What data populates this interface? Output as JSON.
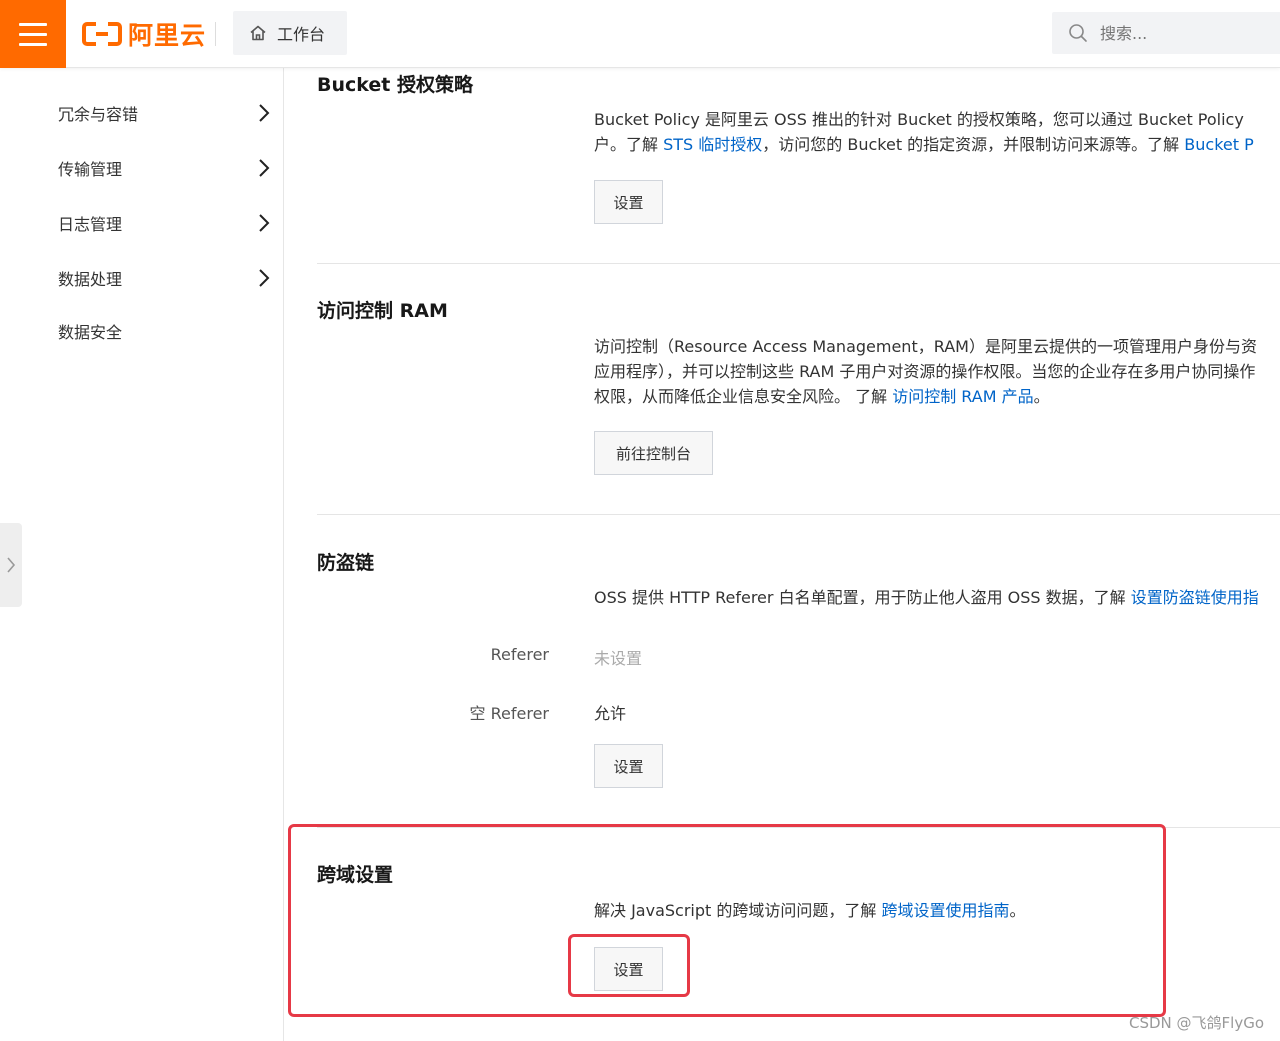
{
  "topbar": {
    "logo_text": "阿里云",
    "workbench_label": "工作台",
    "search_placeholder": "搜索..."
  },
  "sidebar": {
    "items": [
      {
        "label": "冗余与容错",
        "has_arrow": true
      },
      {
        "label": "传输管理",
        "has_arrow": true
      },
      {
        "label": "日志管理",
        "has_arrow": true
      },
      {
        "label": "数据处理",
        "has_arrow": true
      },
      {
        "label": "数据安全",
        "has_arrow": false
      }
    ]
  },
  "sections": {
    "bucket_policy": {
      "title": "Bucket 授权策略",
      "line1": "Bucket Policy 是阿里云 OSS 推出的针对 Bucket 的授权策略，您可以通过 Bucket Policy",
      "line2_prefix": "户。了解 ",
      "line2_link1": "STS 临时授权",
      "line2_middle": "，访问您的 Bucket 的指定资源，并限制访问来源等。了解 ",
      "line2_link2": "Bucket P",
      "button": "设置"
    },
    "ram": {
      "title": "访问控制 RAM",
      "line1": "访问控制（Resource Access Management，RAM）是阿里云提供的一项管理用户身份与资",
      "line2": "应用程序），并可以控制这些 RAM 子用户对资源的操作权限。当您的企业存在多用户协同操作",
      "line3_prefix": "权限，从而降低企业信息安全风险。 了解 ",
      "line3_link": "访问控制 RAM 产品",
      "line3_suffix": "。",
      "button": "前往控制台"
    },
    "hotlink": {
      "title": "防盗链",
      "desc_prefix": "OSS 提供 HTTP Referer 白名单配置，用于防止他人盗用 OSS 数据，了解 ",
      "desc_link": "设置防盗链使用指",
      "referer_label": "Referer",
      "referer_value": "未设置",
      "empty_referer_label": "空 Referer",
      "empty_referer_value": "允许",
      "button": "设置"
    },
    "cors": {
      "title": "跨域设置",
      "desc_prefix": "解决 JavaScript 的跨域访问问题，了解 ",
      "desc_link": "跨域设置使用指南",
      "desc_suffix": "。",
      "button": "设置"
    }
  },
  "watermark": "CSDN @飞鸽FlyGo",
  "colors": {
    "brand": "#ff6a00",
    "link": "#0064c8",
    "highlight": "#e63946"
  }
}
